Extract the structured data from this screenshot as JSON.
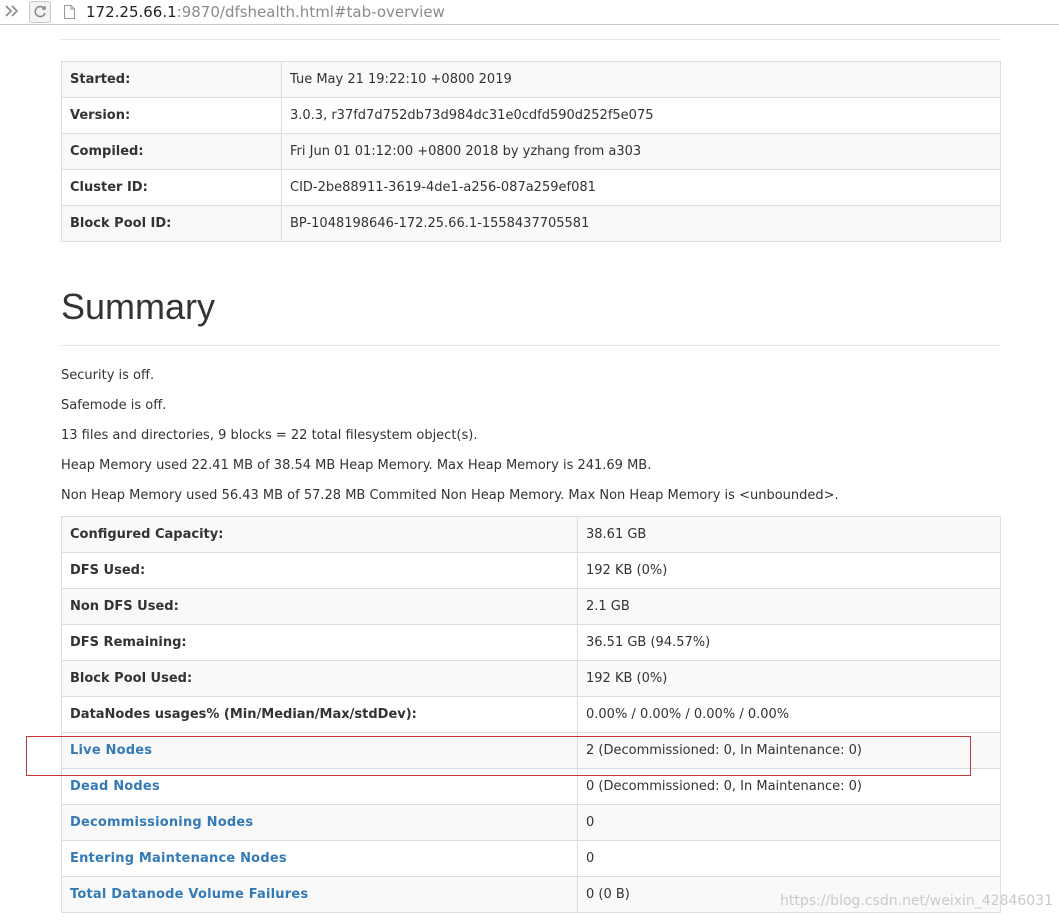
{
  "browser": {
    "url_host": "172.25.66.1",
    "url_rest": ":9870/dfshealth.html#tab-overview",
    "icons": [
      "forward-icon",
      "reload-icon",
      "page-icon"
    ]
  },
  "overview": {
    "rows": [
      {
        "label": "Started:",
        "value": "Tue May 21 19:22:10 +0800 2019"
      },
      {
        "label": "Version:",
        "value": "3.0.3, r37fd7d752db73d984dc31e0cdfd590d252f5e075"
      },
      {
        "label": "Compiled:",
        "value": "Fri Jun 01 01:12:00 +0800 2018 by yzhang from a303"
      },
      {
        "label": "Cluster ID:",
        "value": "CID-2be88911-3619-4de1-a256-087a259ef081"
      },
      {
        "label": "Block Pool ID:",
        "value": "BP-1048198646-172.25.66.1-1558437705581"
      }
    ]
  },
  "summary": {
    "title": "Summary",
    "lines": [
      "Security is off.",
      "Safemode is off.",
      "13 files and directories, 9 blocks = 22 total filesystem object(s).",
      "Heap Memory used 22.41 MB of 38.54 MB Heap Memory. Max Heap Memory is 241.69 MB.",
      "Non Heap Memory used 56.43 MB of 57.28 MB Commited Non Heap Memory. Max Non Heap Memory is <unbounded>."
    ],
    "rows": [
      {
        "label": "Configured Capacity:",
        "value": "38.61 GB"
      },
      {
        "label": "DFS Used:",
        "value": "192 KB (0%)"
      },
      {
        "label": "Non DFS Used:",
        "value": "2.1 GB"
      },
      {
        "label": "DFS Remaining:",
        "value": "36.51 GB (94.57%)"
      },
      {
        "label": "Block Pool Used:",
        "value": "192 KB (0%)"
      },
      {
        "label": "DataNodes usages% (Min/Median/Max/stdDev):",
        "value": "0.00% / 0.00% / 0.00% / 0.00%"
      },
      {
        "label": "Live Nodes",
        "value": "2 (Decommissioned: 0, In Maintenance: 0)"
      },
      {
        "label": "Dead Nodes",
        "value": "0 (Decommissioned: 0, In Maintenance: 0)"
      },
      {
        "label": "Decommissioning Nodes",
        "value": "0"
      },
      {
        "label": "Entering Maintenance Nodes",
        "value": "0"
      },
      {
        "label": "Total Datanode Volume Failures",
        "value": "0 (0 B)"
      }
    ]
  },
  "watermark": "https://blog.csdn.net/weixin_42846031",
  "colors": {
    "link": "#337ab7",
    "highlight": "#c0393b",
    "border": "#dddddd"
  }
}
